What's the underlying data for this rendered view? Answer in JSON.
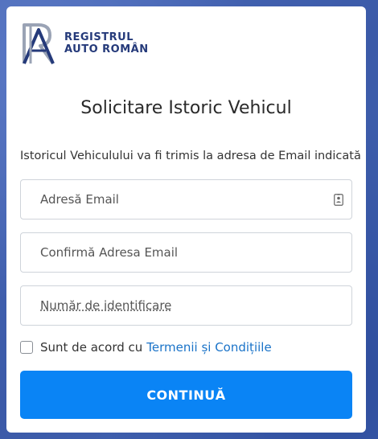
{
  "brand": {
    "logo_line1": "REGISTRUL",
    "logo_line2": "AUTO ROMÂN",
    "text_color": "#253a7a"
  },
  "title": "Solicitare Istoric Vehicul",
  "info_text": "Istoricul Vehiculului va fi trimis la adresa de Email indicată",
  "fields": {
    "email": {
      "placeholder": "Adresă Email",
      "value": "",
      "icon": "contact-card-icon"
    },
    "confirm_email": {
      "placeholder": "Confirmă Adresa Email",
      "value": ""
    },
    "vin": {
      "placeholder": "Număr de identificare",
      "value": ""
    }
  },
  "agree": {
    "checked": false,
    "text": "Sunt de acord cu",
    "link": "Termenii și Condițiile"
  },
  "submit_label": "CONTINUĂ",
  "colors": {
    "accent": "#0a84f5",
    "link": "#1a73c8",
    "background": "#3f5fae"
  }
}
